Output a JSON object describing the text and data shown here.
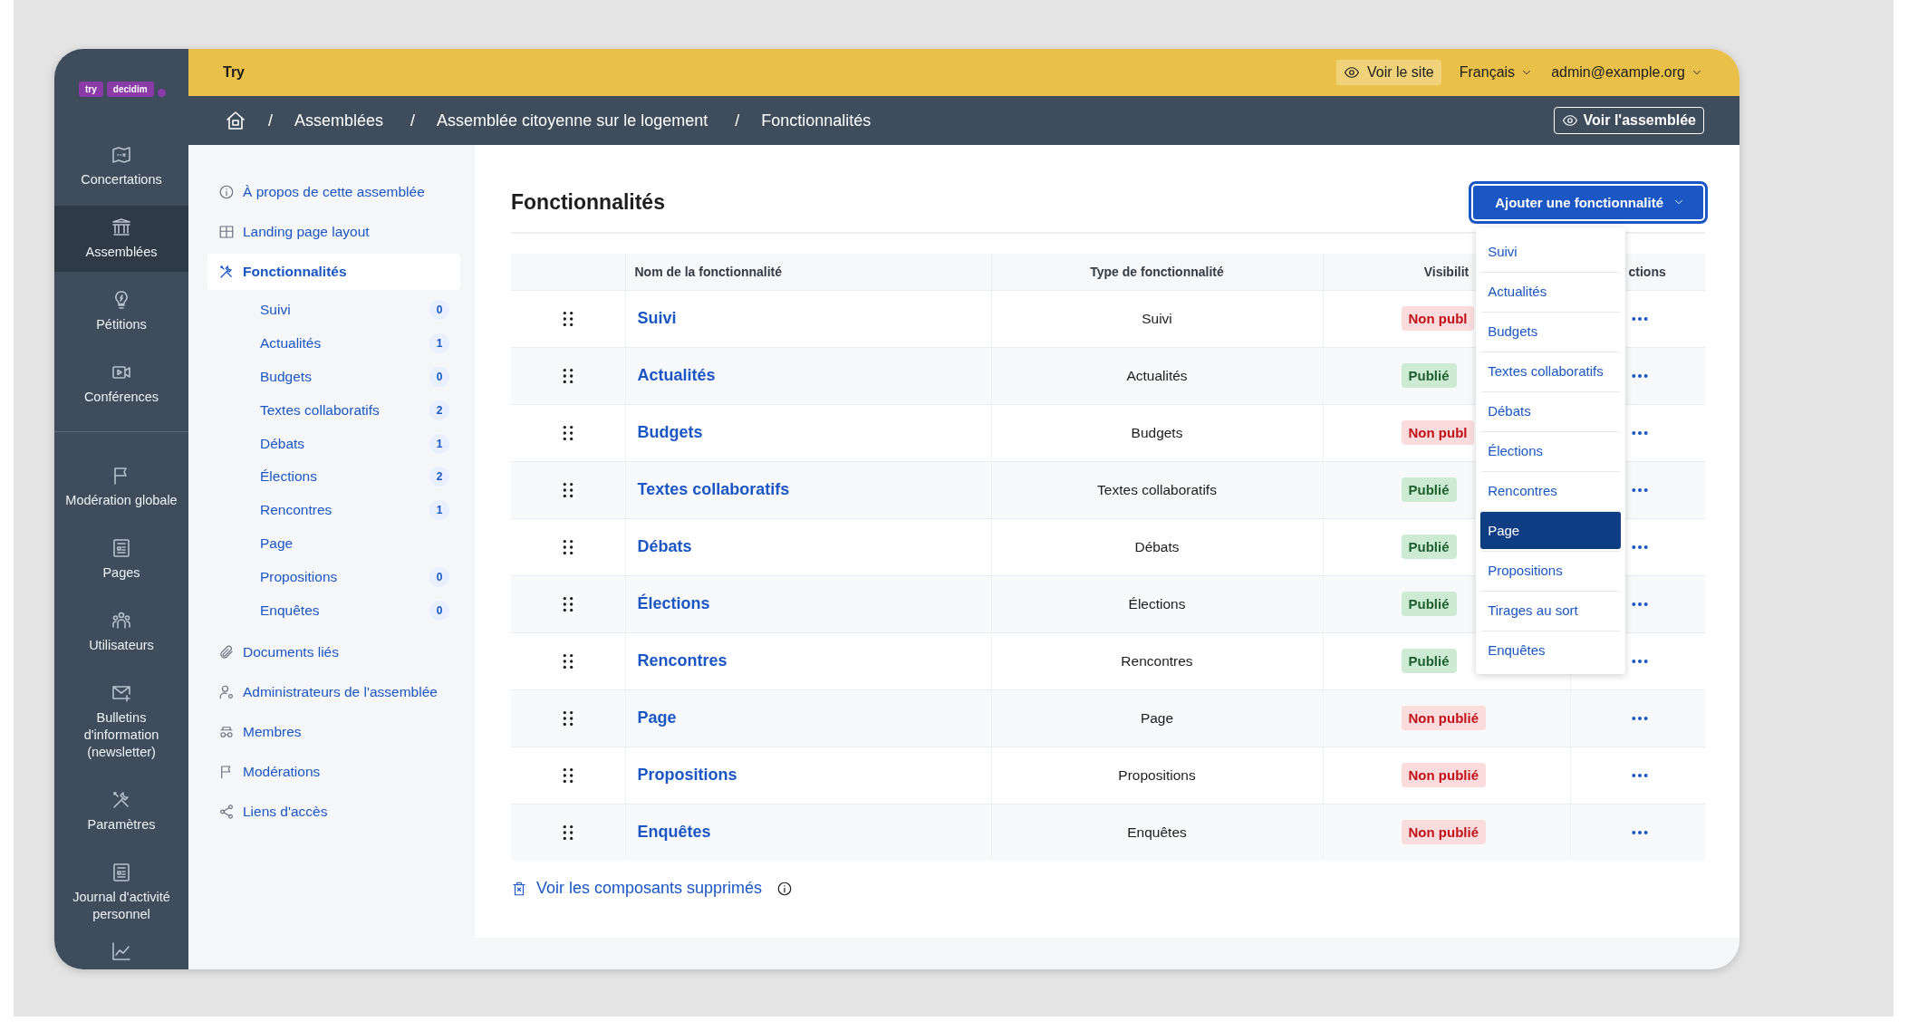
{
  "logo": {
    "tags": [
      "try",
      "decidim"
    ]
  },
  "rail": {
    "groups": [
      {
        "items": [
          {
            "label": "Concertations",
            "selected": false
          },
          {
            "label": "Assemblées",
            "selected": true
          },
          {
            "label": "Pétitions",
            "selected": false
          },
          {
            "label": "Conférences",
            "selected": false
          }
        ]
      },
      {
        "items": [
          {
            "label": "Modération globale",
            "selected": false
          },
          {
            "label": "Pages",
            "selected": false
          },
          {
            "label": "Utilisateurs",
            "selected": false
          },
          {
            "label": "Bulletins d'information (newsletter)",
            "selected": false
          },
          {
            "label": "Paramètres",
            "selected": false
          },
          {
            "label": "Journal d'activité personnel",
            "selected": false
          },
          {
            "selected": false
          }
        ]
      }
    ]
  },
  "topbar": {
    "title": "Try",
    "view_site": "Voir le site",
    "language": "Français",
    "user": "admin@example.org"
  },
  "breadcrumb": {
    "crumbs": [
      {
        "separator": "/",
        "label": "Assemblées"
      },
      {
        "separator": "/",
        "label": "Assemblée citoyenne sur le logement"
      },
      {
        "separator": "/",
        "label": "Fonctionnalités"
      }
    ],
    "action": "Voir l'assemblée"
  },
  "subnav": {
    "items": [
      {
        "label": "À propos de cette assemblée",
        "selected": false
      },
      {
        "label": "Landing page layout",
        "selected": false
      },
      {
        "label": "Fonctionnalités",
        "selected": true,
        "children": [
          {
            "label": "Suivi",
            "count": "0"
          },
          {
            "label": "Actualités",
            "count": "1"
          },
          {
            "label": "Budgets",
            "count": "0"
          },
          {
            "label": "Textes collaboratifs",
            "count": "2"
          },
          {
            "label": "Débats",
            "count": "1"
          },
          {
            "label": "Élections",
            "count": "2"
          },
          {
            "label": "Rencontres",
            "count": "1"
          },
          {
            "label": "Page"
          },
          {
            "label": "Propositions",
            "count": "0"
          },
          {
            "label": "Enquêtes",
            "count": "0"
          }
        ]
      },
      {
        "label": "Documents liés",
        "selected": false
      },
      {
        "label": "Administrateurs de l'assemblée",
        "selected": false
      },
      {
        "label": "Membres",
        "selected": false
      },
      {
        "label": "Modérations",
        "selected": false
      },
      {
        "label": "Liens d'accès",
        "selected": false
      }
    ]
  },
  "main": {
    "title": "Fonctionnalités",
    "add_button": "Ajouter une fonctionnalité",
    "dropdown": {
      "items": [
        {
          "label": "Suivi",
          "selected": false
        },
        {
          "label": "Actualités",
          "selected": false
        },
        {
          "label": "Budgets",
          "selected": false
        },
        {
          "label": "Textes collaboratifs",
          "selected": false
        },
        {
          "label": "Débats",
          "selected": false
        },
        {
          "label": "Élections",
          "selected": false
        },
        {
          "label": "Rencontres",
          "selected": false
        },
        {
          "label": "Page",
          "selected": true
        },
        {
          "label": "Propositions",
          "selected": false
        },
        {
          "label": "Tirages au sort",
          "selected": false
        },
        {
          "label": "Enquêtes",
          "selected": false
        }
      ]
    },
    "table": {
      "columns": [
        "Nom de la fonctionnalité",
        "Type de fonctionnalité",
        "Visibilit",
        "ctions"
      ],
      "rows": [
        {
          "name": "Suivi",
          "type": "Suivi",
          "visibility": "Non publ",
          "published": false
        },
        {
          "name": "Actualités",
          "type": "Actualités",
          "visibility": "Publié",
          "published": true
        },
        {
          "name": "Budgets",
          "type": "Budgets",
          "visibility": "Non publ",
          "published": false
        },
        {
          "name": "Textes collaboratifs",
          "type": "Textes collaboratifs",
          "visibility": "Publié",
          "published": true
        },
        {
          "name": "Débats",
          "type": "Débats",
          "visibility": "Publié",
          "published": true
        },
        {
          "name": "Élections",
          "type": "Élections",
          "visibility": "Publié",
          "published": true
        },
        {
          "name": "Rencontres",
          "type": "Rencontres",
          "visibility": "Publié",
          "published": true
        },
        {
          "name": "Page",
          "type": "Page",
          "visibility": "Non publié",
          "published": false
        },
        {
          "name": "Propositions",
          "type": "Propositions",
          "visibility": "Non publié",
          "published": false
        },
        {
          "name": "Enquêtes",
          "type": "Enquêtes",
          "visibility": "Non publié",
          "published": false
        }
      ]
    },
    "deleted_link": "Voir les composants supprimés"
  }
}
